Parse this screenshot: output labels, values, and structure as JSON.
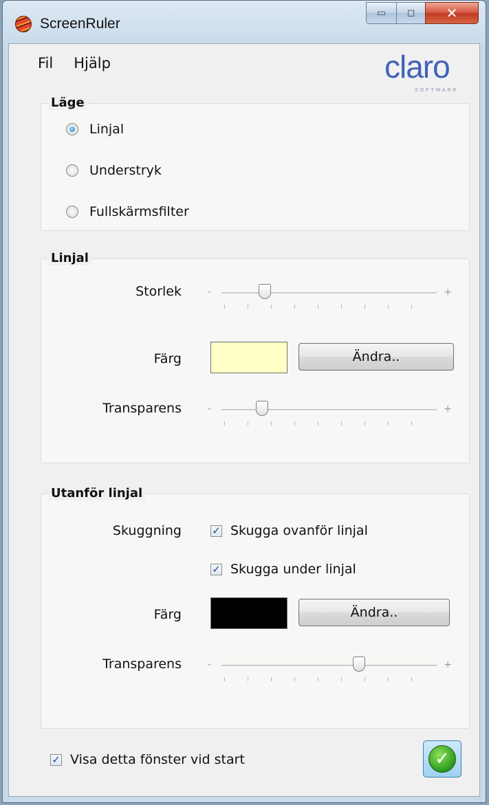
{
  "window": {
    "title": "ScreenRuler",
    "icon": "screenruler-app-icon",
    "caption_buttons": [
      "minimize",
      "maximize",
      "close"
    ],
    "caption_glyphs": {
      "minimize": "▭",
      "maximize": "◻",
      "close": "✕"
    }
  },
  "menu": {
    "items": [
      "Fil",
      "Hjälp"
    ]
  },
  "logo": {
    "word": "claro",
    "sub": "SOFTWARE"
  },
  "mode_group": {
    "title": "Läge",
    "options": [
      {
        "label": "Linjal",
        "checked": true
      },
      {
        "label": "Understryk",
        "checked": false
      },
      {
        "label": "Fullskärmsfilter",
        "checked": false
      }
    ]
  },
  "ruler_group": {
    "title": "Linjal",
    "size_label": "Storlek",
    "size_value": 0.2,
    "color_label": "Färg",
    "color": "#ffffc6",
    "change_label": "Ändra..",
    "transparency_label": "Transparens",
    "transparency_value": 0.19
  },
  "outside_group": {
    "title": "Utanför linjal",
    "shading_label": "Skuggning",
    "shade_above": {
      "label": "Skugga ovanför linjal",
      "checked": true
    },
    "shade_below": {
      "label": "Skugga under linjal",
      "checked": true
    },
    "color_label": "Färg",
    "color": "#000000",
    "change_label": "Ändra..",
    "transparency_label": "Transparens",
    "transparency_value": 0.64
  },
  "footer": {
    "show_on_start": {
      "label": "Visa detta fönster vid start",
      "checked": true
    },
    "ok_glyph": "✓"
  }
}
